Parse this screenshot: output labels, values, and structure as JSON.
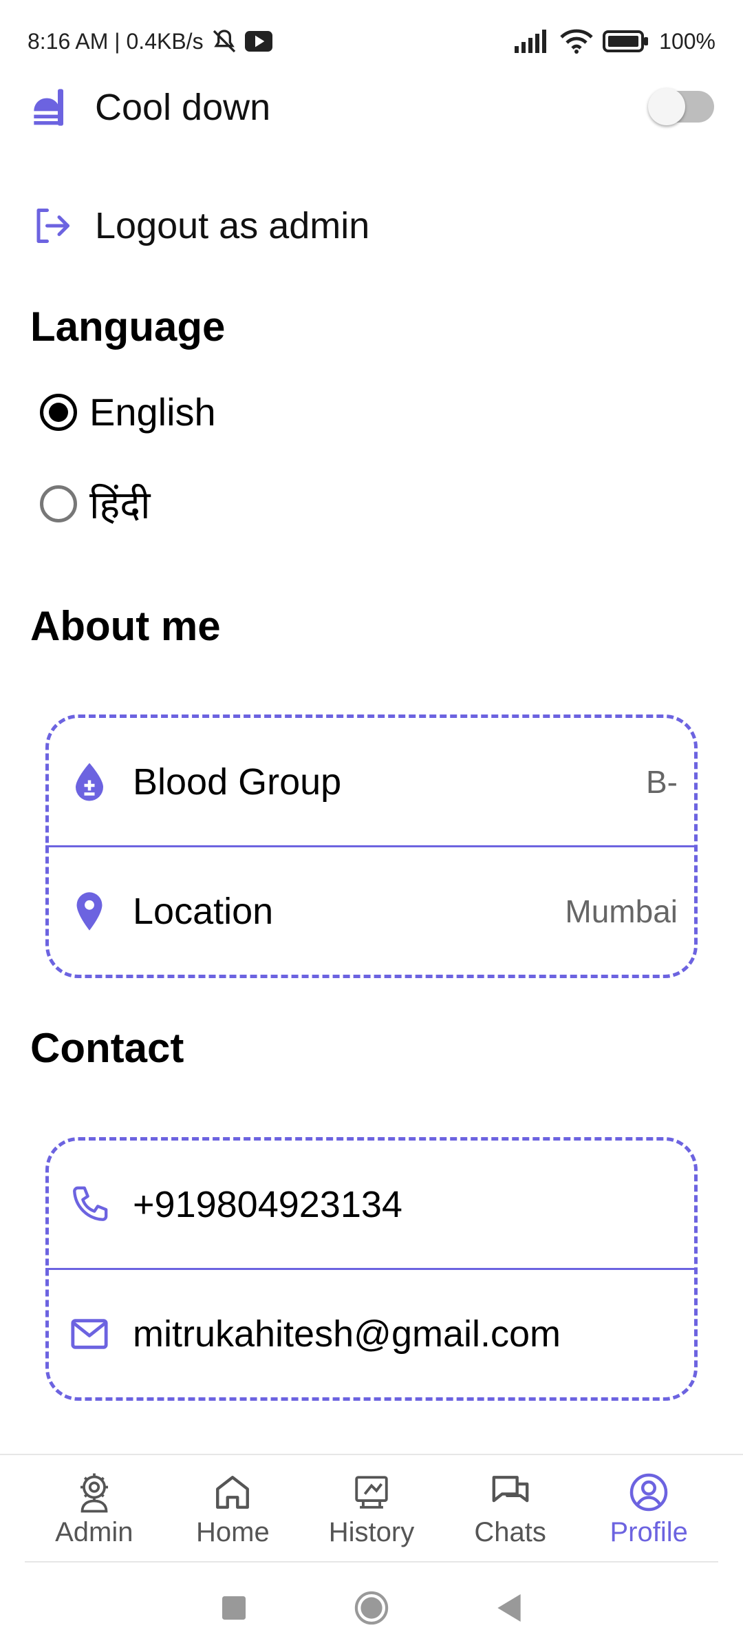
{
  "status_bar": {
    "time_speed": "8:16 AM | 0.4KB/s",
    "battery": "100%"
  },
  "settings": {
    "cool_down_label": "Cool down",
    "cool_down_enabled": false,
    "logout_label": "Logout as admin"
  },
  "language": {
    "title": "Language",
    "options": [
      {
        "label": "English",
        "selected": true
      },
      {
        "label": "हिंदी",
        "selected": false
      }
    ]
  },
  "about": {
    "title": "About me",
    "blood_group_label": "Blood Group",
    "blood_group_value": "B-",
    "location_label": "Location",
    "location_value": "Mumbai"
  },
  "contact": {
    "title": "Contact",
    "phone": "+919804923134",
    "email": "mitrukahitesh@gmail.com"
  },
  "bottom_nav": {
    "items": [
      {
        "label": "Admin",
        "icon": "admin-gear-icon"
      },
      {
        "label": "Home",
        "icon": "home-icon"
      },
      {
        "label": "History",
        "icon": "history-icon"
      },
      {
        "label": "Chats",
        "icon": "chats-icon"
      },
      {
        "label": "Profile",
        "icon": "profile-icon",
        "active": true
      }
    ]
  },
  "colors": {
    "accent": "#6c63e0",
    "text": "#000000",
    "muted": "#666666"
  }
}
